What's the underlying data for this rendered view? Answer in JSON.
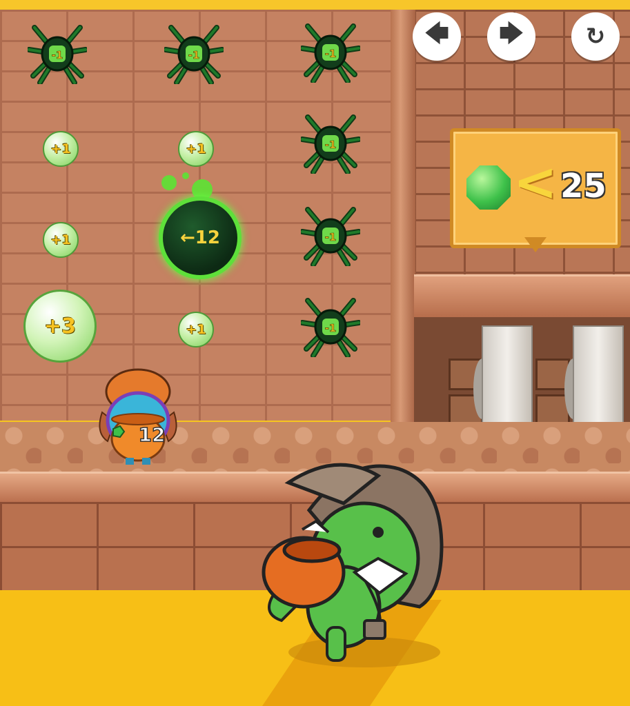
{
  "nav": {
    "back_icon": "arrow-left-icon",
    "forward_icon": "arrow-right-icon",
    "restart_icon": "restart-icon"
  },
  "board": {
    "spider_value": "-1",
    "gem_small_value": "+1",
    "gem_big_value": "+3",
    "bomb_value": "←12"
  },
  "rule_sign": {
    "operator": "<",
    "target": "25"
  },
  "player": {
    "gem_count": "12"
  },
  "colors": {
    "gem_green": "#3ec14a",
    "spider_green": "#1f7a2a",
    "bomb_glow": "#5ee03a",
    "sign_orange": "#f5b545",
    "label_yellow": "#f7c322"
  }
}
